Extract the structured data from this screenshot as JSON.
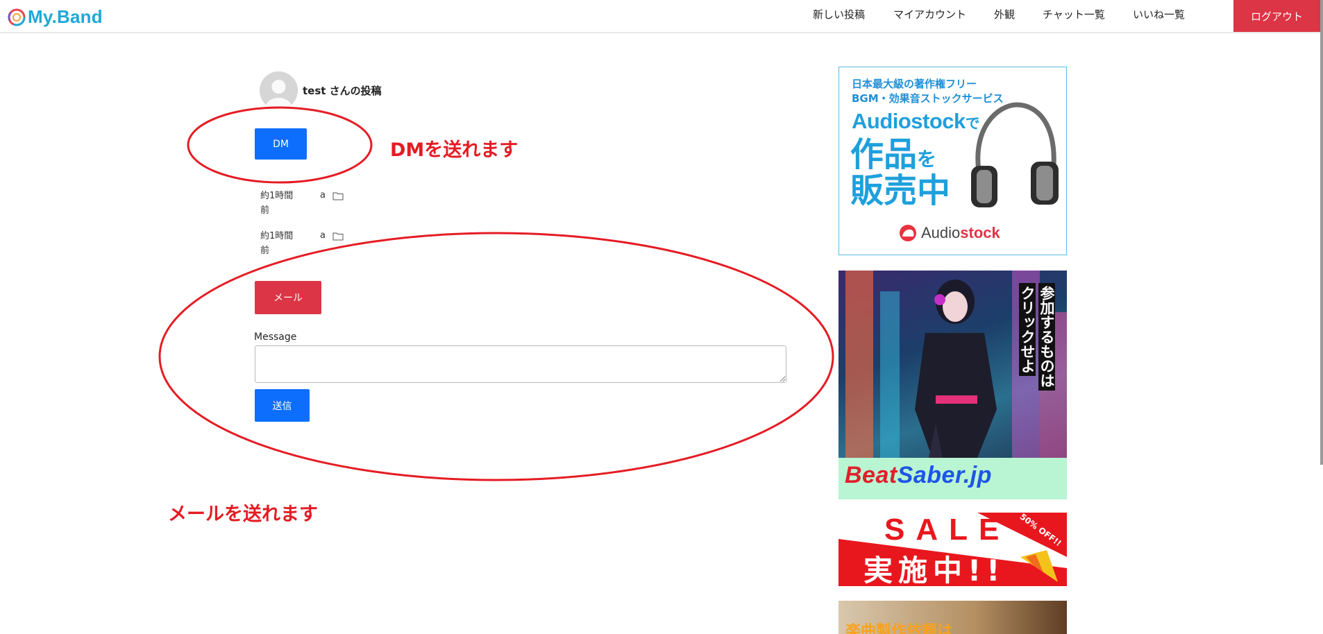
{
  "header": {
    "logo_text": "My.Band",
    "nav": [
      "新しい投稿",
      "マイアカウント",
      "外観",
      "チャット一覧",
      "いいね一覧"
    ],
    "logout_label": "ログアウト"
  },
  "post": {
    "title": "test さんの投稿",
    "dm_label": "DM",
    "rows": [
      {
        "time": "約1時間前",
        "user": "a"
      },
      {
        "time": "約1時間前",
        "user": "a"
      }
    ],
    "mail_label": "メール",
    "message_label": "Message",
    "message_value": "",
    "send_label": "送信"
  },
  "annotations": {
    "dm_note": "DMを送れます",
    "mail_note": "メールを送れます",
    "color": "#e51b23"
  },
  "ads": {
    "audiostock": {
      "line1": "日本最大級の著作権フリー",
      "line2": "BGM・効果音ストックサービス",
      "big1": "Audiostock",
      "big1_suffix": "で",
      "big2": "作品",
      "big2_suffix": "を",
      "big3": "販売中",
      "brand_a": "Audio",
      "brand_b": "stock"
    },
    "beatsaber": {
      "vert1": "参加するものは",
      "vert2": "クリックせよ",
      "brand_a": "Beat",
      "brand_b": "Saber.jp"
    },
    "sale": {
      "sale": "SALE",
      "jisshi": "実施中!!",
      "off": "50% OFF!!"
    },
    "request": {
      "text": "楽曲製作依頼は"
    }
  },
  "colors": {
    "primary": "#0d6efd",
    "danger": "#dc3545",
    "logo": "#1fa8d8"
  }
}
